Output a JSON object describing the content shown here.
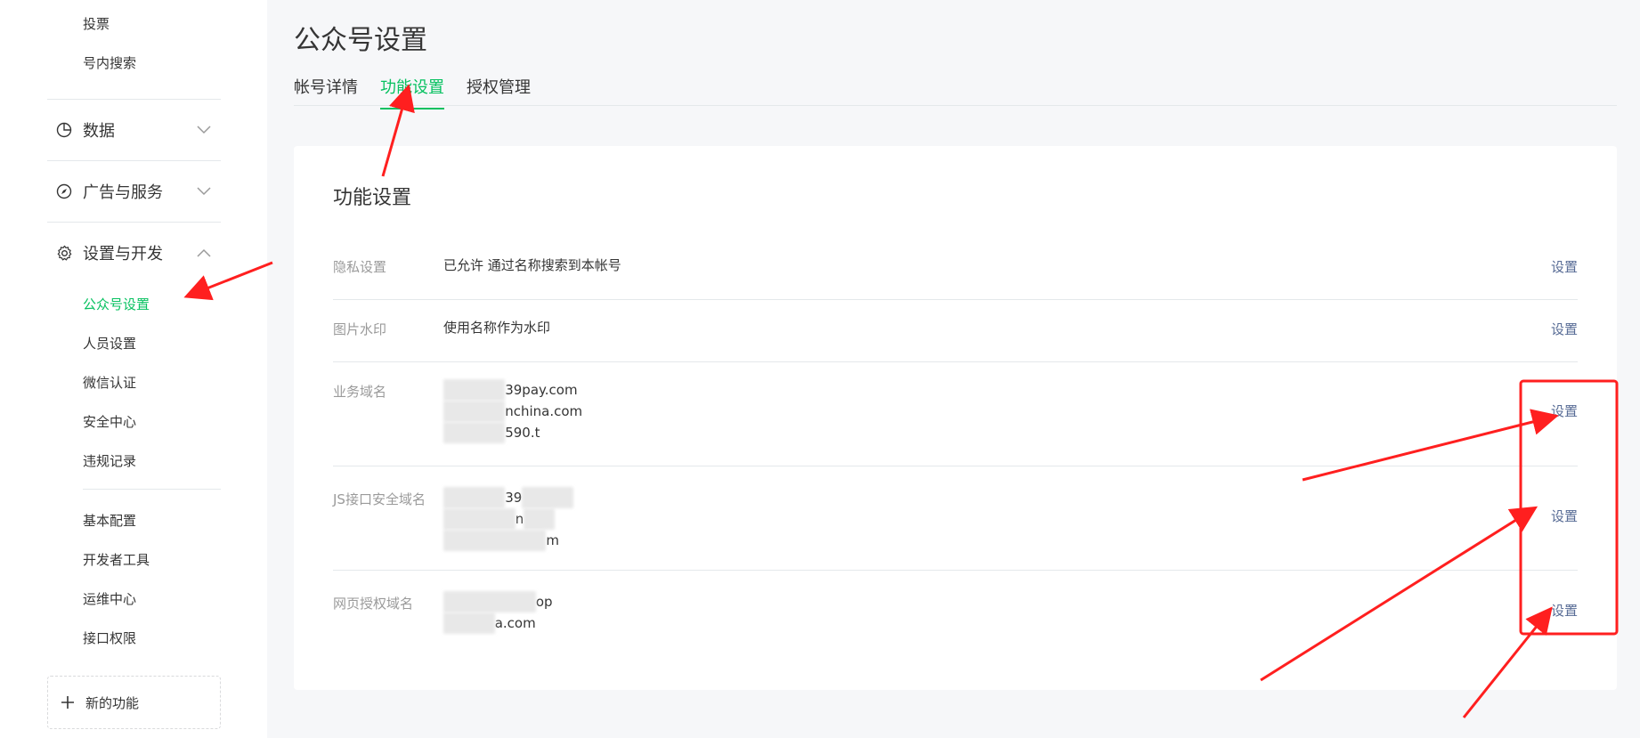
{
  "sidebar": {
    "top_items": [
      {
        "label": "投票"
      },
      {
        "label": "号内搜索"
      }
    ],
    "menus": {
      "data": {
        "label": "数据"
      },
      "ads": {
        "label": "广告与服务"
      },
      "settings": {
        "label": "设置与开发"
      }
    },
    "settings_items": [
      {
        "label": "公众号设置"
      },
      {
        "label": "人员设置"
      },
      {
        "label": "微信认证"
      },
      {
        "label": "安全中心"
      },
      {
        "label": "违规记录"
      }
    ],
    "dev_items": [
      {
        "label": "基本配置"
      },
      {
        "label": "开发者工具"
      },
      {
        "label": "运维中心"
      },
      {
        "label": "接口权限"
      }
    ],
    "new_feature": {
      "label": "新的功能"
    }
  },
  "page": {
    "title": "公众号设置",
    "tabs": [
      {
        "label": "帐号详情"
      },
      {
        "label": "功能设置"
      },
      {
        "label": "授权管理"
      }
    ]
  },
  "card": {
    "title": "功能设置",
    "rows": [
      {
        "label": "隐私设置",
        "value": "已允许 通过名称搜索到本帐号",
        "action": "设置"
      },
      {
        "label": "图片水印",
        "value": "使用名称作为水印",
        "action": "设置"
      },
      {
        "label": "业务域名",
        "values": [
          "39pay.com",
          "nchina.com",
          "590.t"
        ],
        "action": "设置"
      },
      {
        "label": "JS接口安全域名",
        "values": [
          "39",
          "n",
          "m"
        ],
        "action": "设置"
      },
      {
        "label": "网页授权域名",
        "values": [
          "op",
          "a.com"
        ],
        "action": "设置"
      }
    ]
  },
  "colors": {
    "accent": "#07c160",
    "link": "#576b95",
    "annotation": "#ff1f1f"
  }
}
